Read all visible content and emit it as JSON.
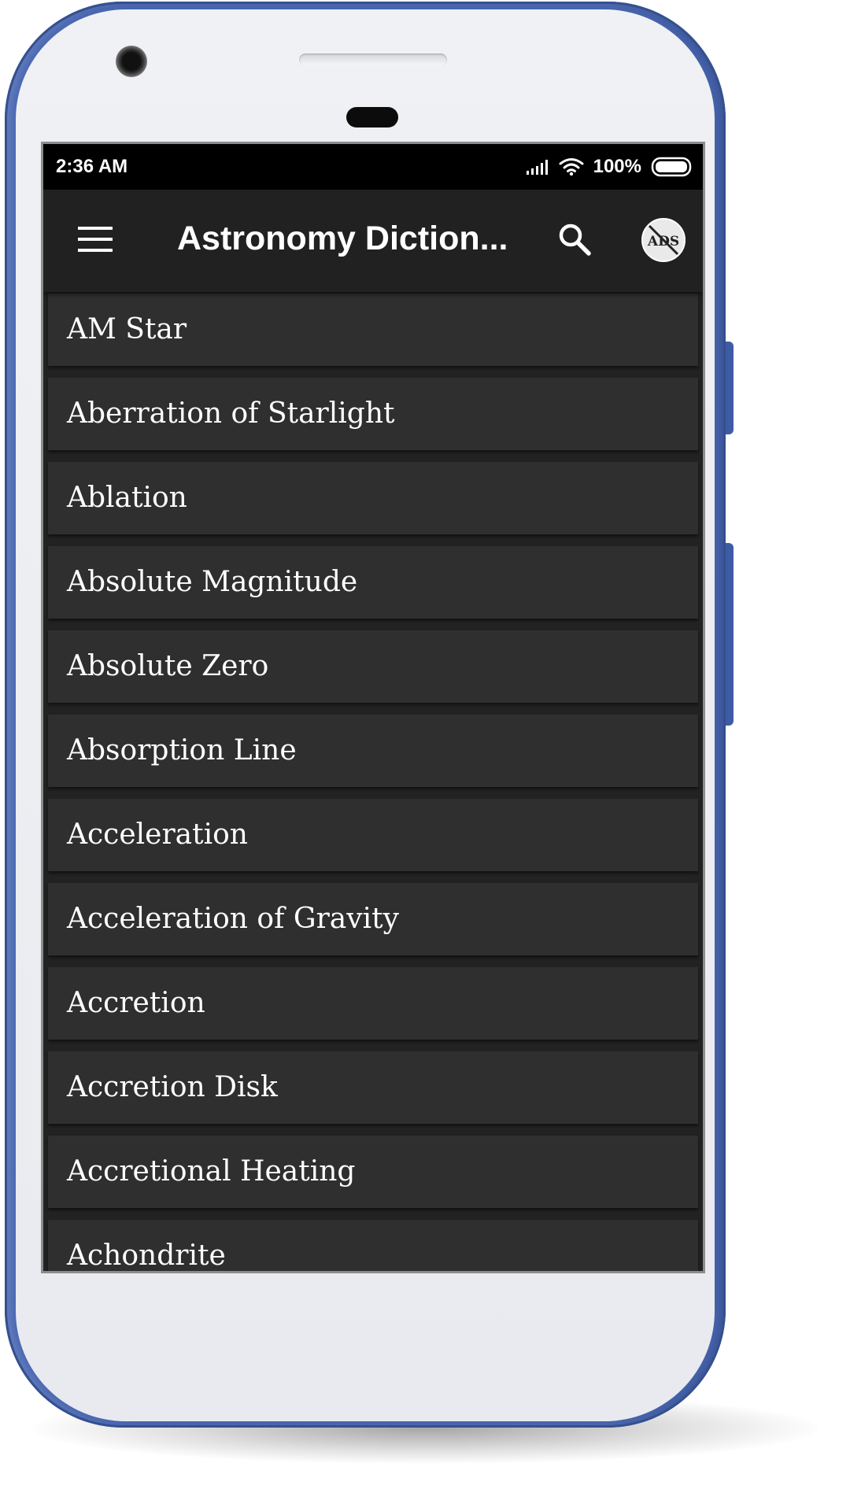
{
  "status_bar": {
    "time": "2:36 AM",
    "battery_percent": "100%",
    "icons": [
      "signal-icon",
      "wifi-icon",
      "battery-icon"
    ]
  },
  "app_bar": {
    "title": "Astronomy Diction...",
    "icons": [
      "menu-icon",
      "search-icon",
      "no-ads-icon"
    ],
    "no_ads_badge": "ADS"
  },
  "terms": [
    {
      "label": "AM Star"
    },
    {
      "label": "Aberration of Starlight"
    },
    {
      "label": "Ablation"
    },
    {
      "label": "Absolute Magnitude"
    },
    {
      "label": "Absolute Zero"
    },
    {
      "label": "Absorption Line"
    },
    {
      "label": "Acceleration"
    },
    {
      "label": "Acceleration of Gravity"
    },
    {
      "label": "Accretion"
    },
    {
      "label": "Accretion Disk"
    },
    {
      "label": "Accretional Heating"
    },
    {
      "label": "Achondrite"
    }
  ],
  "colors": {
    "device_frame": "#4765b1",
    "device_face": "#eceef2",
    "app_bar": "#212121",
    "list_item": "#2f2f2f",
    "list_background": "#222222",
    "text": "#ffffff"
  }
}
